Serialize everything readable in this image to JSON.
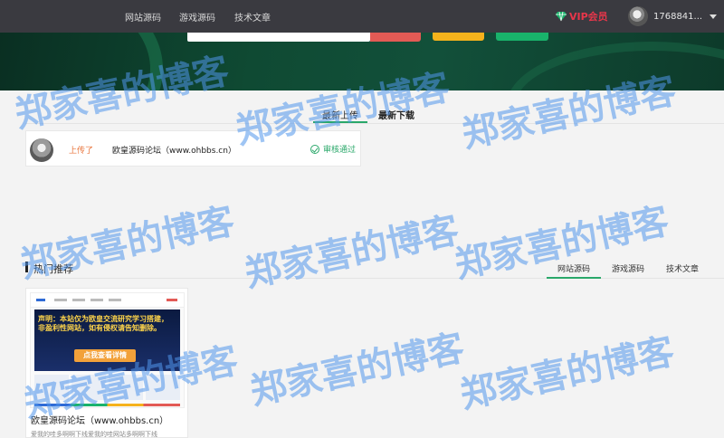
{
  "nav": {
    "items": [
      {
        "label": "网站源码"
      },
      {
        "label": "游戏源码"
      },
      {
        "label": "技术文章"
      }
    ],
    "vip_label": "VIP会员",
    "user_name": "1768841..."
  },
  "tabs": {
    "latest_upload": "最新上传",
    "latest_download": "最新下载"
  },
  "upload": {
    "action": "上传了",
    "title": "欧皇源码论坛（www.ohbbs.cn）",
    "status": "审核通过"
  },
  "hot": {
    "title": "热门推荐",
    "tabs": [
      {
        "label": "网站源码"
      },
      {
        "label": "游戏源码"
      },
      {
        "label": "技术文章"
      }
    ]
  },
  "product": {
    "title": "欧皇源码论坛（www.ohbbs.cn）",
    "desc": "爱我的哇多啊啊下线爱我的哇网站多啊啊下线",
    "thumb_text": "声明：本站仅为欧皇交流研究学习搭建，非盈利性网站，如有侵权请告知删除。",
    "thumb_button": "点我查看详情"
  },
  "watermark": "郑家喜的博客",
  "colors": {
    "accent_green": "#2aa86a",
    "vip_red": "#e8364a",
    "upload_orange": "#e8733a",
    "topbar": "#3a3a40"
  }
}
